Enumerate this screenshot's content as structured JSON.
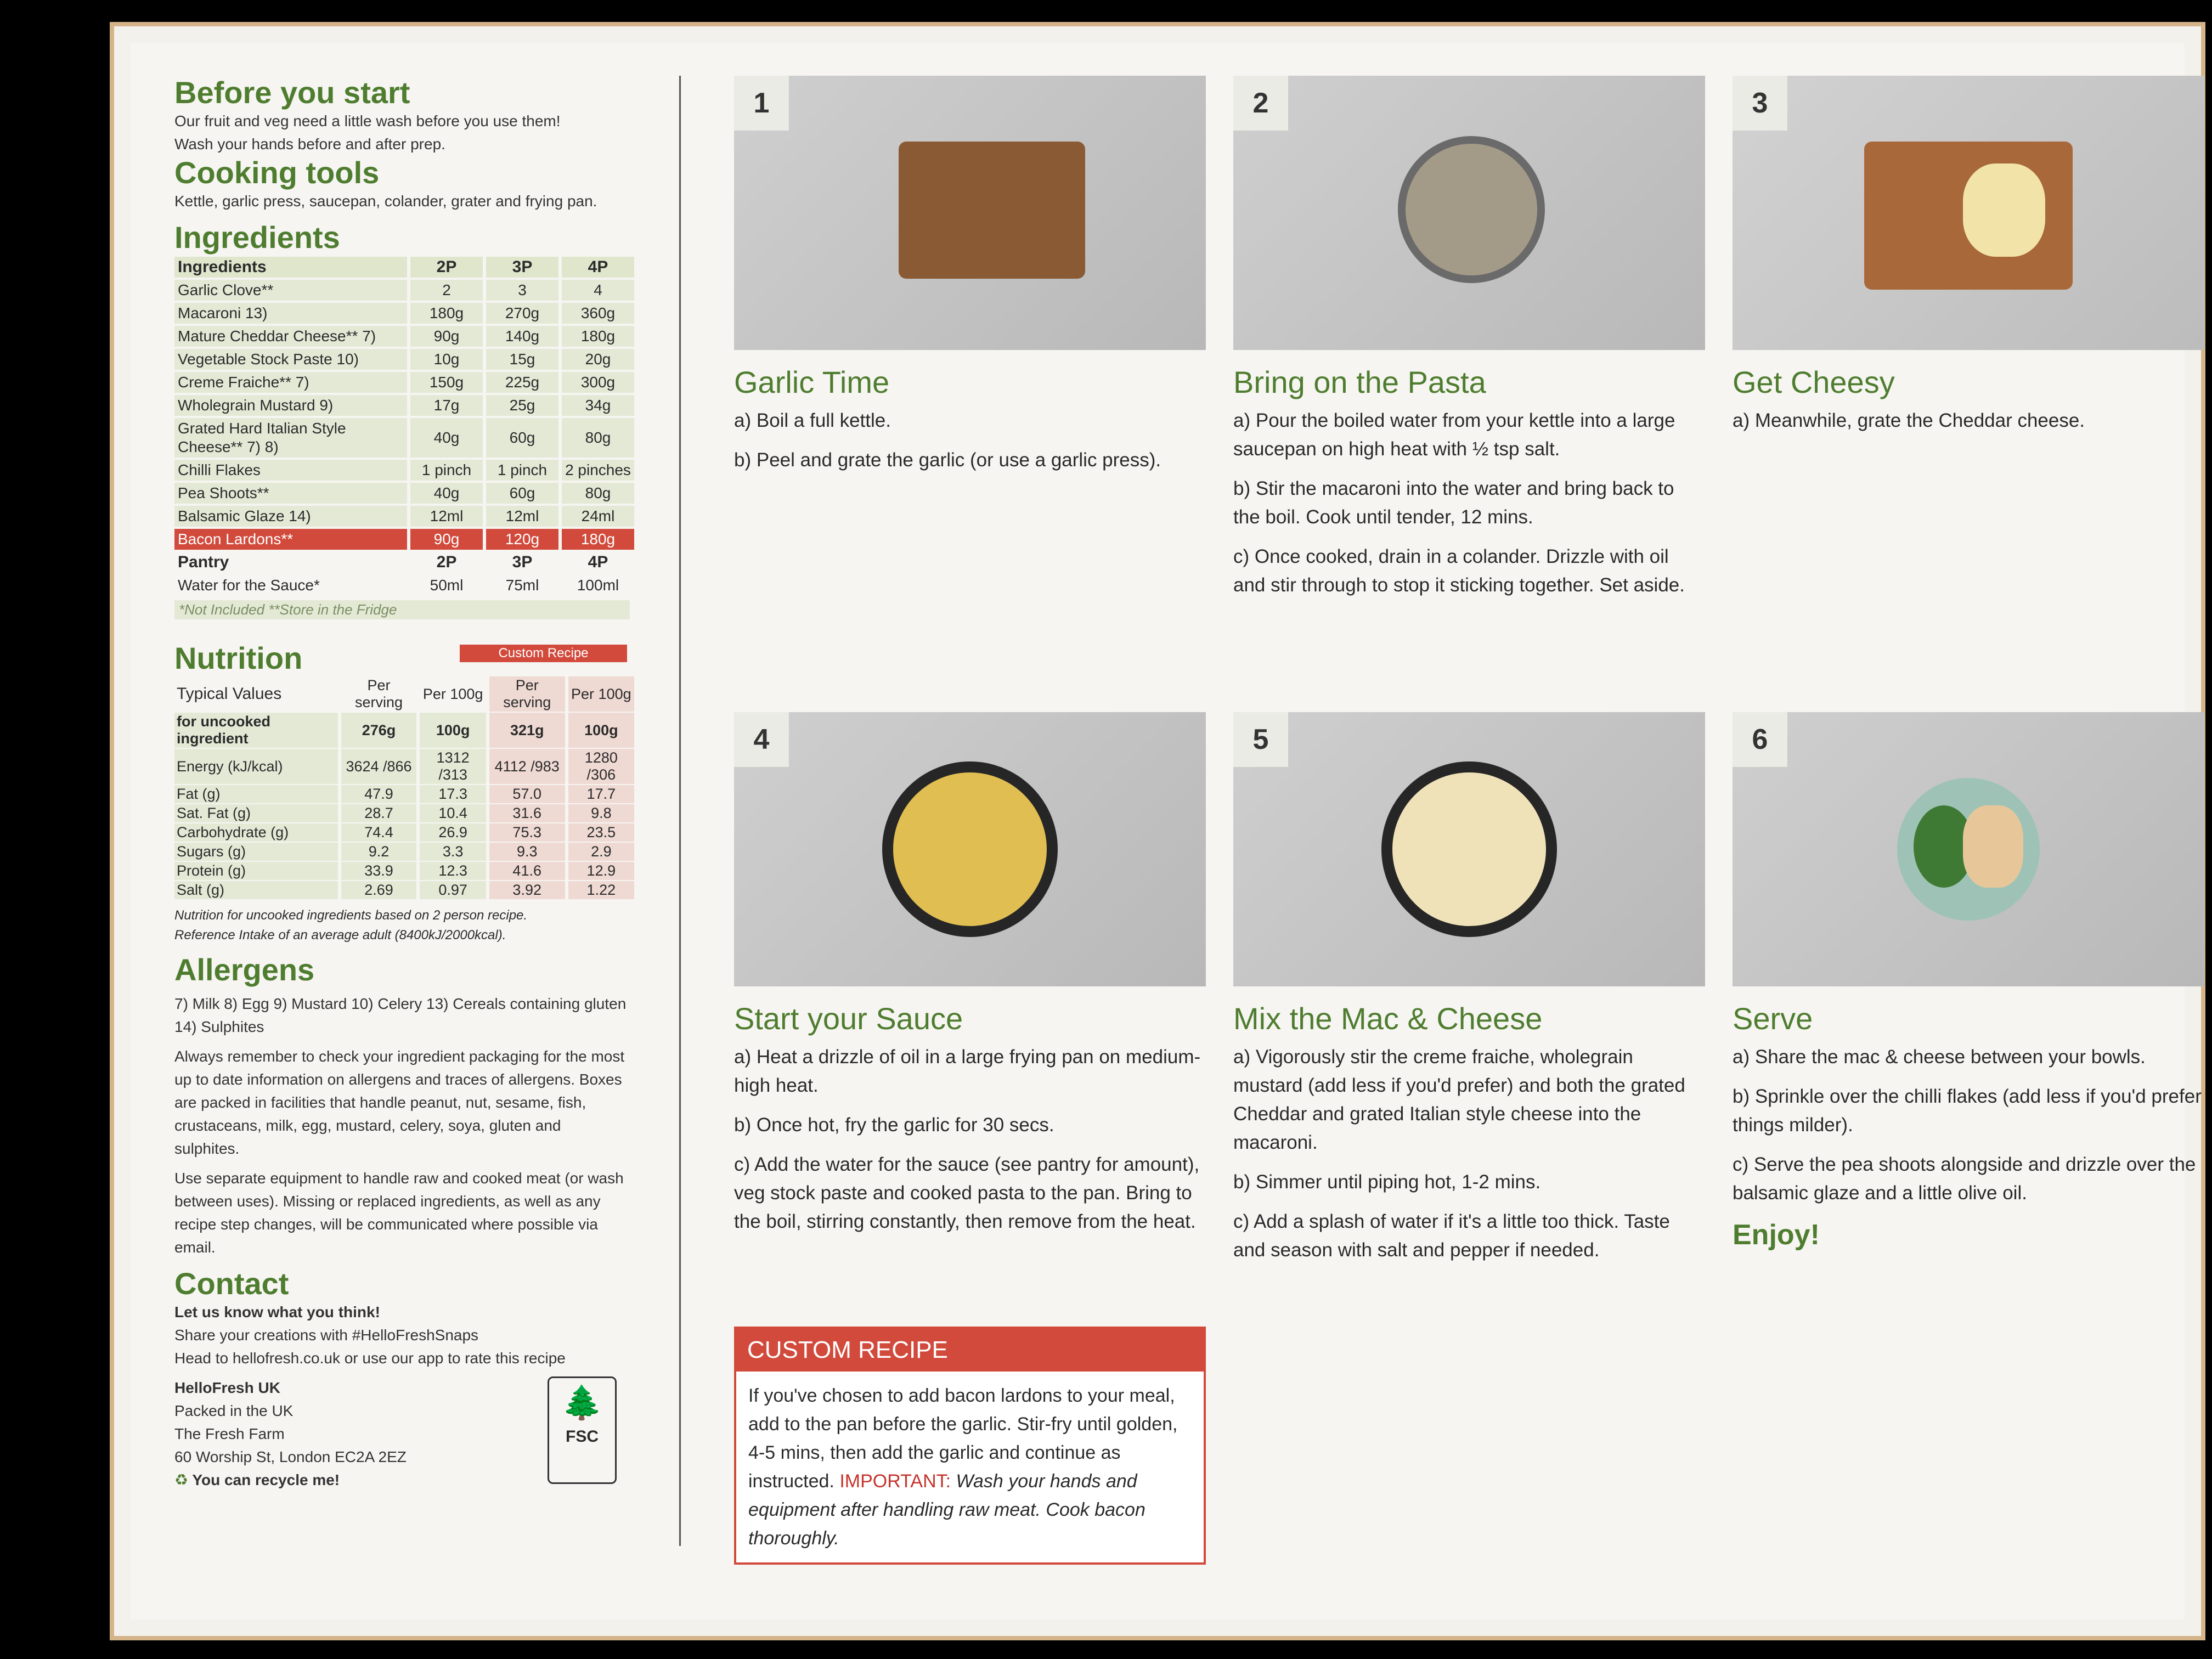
{
  "before": {
    "title": "Before you start",
    "l1": "Our fruit and veg need a little wash before you use them!",
    "l2": "Wash your hands before and after prep."
  },
  "tools": {
    "title": "Cooking tools",
    "text": "Kettle, garlic press, saucepan, colander, grater and frying pan."
  },
  "ingredients": {
    "title": "Ingredients",
    "header": [
      "Ingredients",
      "2P",
      "3P",
      "4P"
    ],
    "rows": [
      [
        "Garlic Clove**",
        "2",
        "3",
        "4"
      ],
      [
        "Macaroni 13)",
        "180g",
        "270g",
        "360g"
      ],
      [
        "Mature Cheddar Cheese** 7)",
        "90g",
        "140g",
        "180g"
      ],
      [
        "Vegetable Stock Paste 10)",
        "10g",
        "15g",
        "20g"
      ],
      [
        "Creme Fraiche** 7)",
        "150g",
        "225g",
        "300g"
      ],
      [
        "Wholegrain Mustard 9)",
        "17g",
        "25g",
        "34g"
      ],
      [
        "Grated Hard Italian Style Cheese** 7) 8)",
        "40g",
        "60g",
        "80g"
      ],
      [
        "Chilli Flakes",
        "1 pinch",
        "1 pinch",
        "2 pinches"
      ],
      [
        "Pea Shoots**",
        "40g",
        "60g",
        "80g"
      ],
      [
        "Balsamic Glaze 14)",
        "12ml",
        "12ml",
        "24ml"
      ]
    ],
    "custom_row": [
      "Bacon Lardons**",
      "90g",
      "120g",
      "180g"
    ],
    "pantry_header": [
      "Pantry",
      "2P",
      "3P",
      "4P"
    ],
    "pantry_row": [
      "Water for the Sauce*",
      "50ml",
      "75ml",
      "100ml"
    ],
    "footnote": "*Not Included  **Store in the Fridge"
  },
  "nutrition": {
    "title": "Nutrition",
    "custom_label": "Custom Recipe",
    "header": [
      "Typical Values",
      "Per serving",
      "Per 100g",
      "Per serving",
      "Per 100g"
    ],
    "rows": [
      [
        "for uncooked ingredient",
        "276g",
        "100g",
        "321g",
        "100g"
      ],
      [
        "Energy (kJ/kcal)",
        "3624 /866",
        "1312 /313",
        "4112 /983",
        "1280 /306"
      ],
      [
        "Fat (g)",
        "47.9",
        "17.3",
        "57.0",
        "17.7"
      ],
      [
        "Sat. Fat (g)",
        "28.7",
        "10.4",
        "31.6",
        "9.8"
      ],
      [
        "Carbohydrate (g)",
        "74.4",
        "26.9",
        "75.3",
        "23.5"
      ],
      [
        "Sugars (g)",
        "9.2",
        "3.3",
        "9.3",
        "2.9"
      ],
      [
        "Protein (g)",
        "33.9",
        "12.3",
        "41.6",
        "12.9"
      ],
      [
        "Salt (g)",
        "2.69",
        "0.97",
        "3.92",
        "1.22"
      ]
    ],
    "note1": "Nutrition for uncooked ingredients based on 2 person recipe.",
    "note2": "Reference Intake of an average adult (8400kJ/2000kcal)."
  },
  "allergens": {
    "title": "Allergens",
    "list": "7) Milk 8) Egg 9) Mustard 10) Celery 13) Cereals containing gluten 14) Sulphites",
    "p1": "Always remember to check your ingredient packaging for the most up to date information on allergens and traces of allergens. Boxes are packed in facilities that handle peanut, nut, sesame, fish, crustaceans, milk, egg, mustard, celery, soya, gluten and sulphites.",
    "p2": "Use separate equipment to handle raw and cooked meat (or wash between uses). Missing or replaced ingredients, as well as any recipe step changes, will be communicated where possible via email."
  },
  "contact": {
    "title": "Contact",
    "l1": "Let us know what you think!",
    "l2": "Share your creations with #HelloFreshSnaps",
    "l3": "Head to hellofresh.co.uk or use our app to rate this recipe",
    "company": "HelloFresh UK",
    "a1": "Packed in the UK",
    "a2": "The Fresh Farm",
    "a3": "60 Worship St, London EC2A 2EZ",
    "recycle": "You can recycle me!",
    "fsc": "FSC"
  },
  "steps": [
    {
      "num": "1",
      "title": "Garlic Time",
      "lines": [
        "a) Boil a full kettle.",
        "b) Peel and grate the garlic (or use a garlic press)."
      ]
    },
    {
      "num": "2",
      "title": "Bring on the Pasta",
      "lines": [
        "a) Pour the boiled water from your kettle into a large saucepan on high heat with ½ tsp salt.",
        "b) Stir the macaroni into the water and bring back to the boil. Cook until tender, 12 mins.",
        "c) Once cooked, drain in a colander. Drizzle with oil and stir through to stop it sticking together. Set aside."
      ]
    },
    {
      "num": "3",
      "title": "Get Cheesy",
      "lines": [
        "a) Meanwhile, grate the Cheddar cheese."
      ]
    },
    {
      "num": "4",
      "title": "Start your Sauce",
      "lines": [
        "a) Heat a drizzle of oil in a large frying pan on medium-high heat.",
        "b) Once hot, fry the garlic for 30 secs.",
        "c) Add the water for the sauce (see pantry for amount), veg stock paste and cooked pasta to the pan. Bring to the boil, stirring constantly, then remove from the heat."
      ]
    },
    {
      "num": "5",
      "title": "Mix the Mac & Cheese",
      "lines": [
        "a) Vigorously stir the creme fraiche, wholegrain mustard (add less if you'd prefer) and both the grated Cheddar and grated Italian style cheese into the macaroni.",
        "b) Simmer until piping hot, 1-2 mins.",
        "c) Add a splash of water if it's a little too thick. Taste and season with salt and pepper if needed."
      ]
    },
    {
      "num": "6",
      "title": "Serve",
      "lines": [
        "a) Share the mac & cheese between your bowls.",
        "b) Sprinkle over the chilli flakes (add less if you'd prefer things milder).",
        "c) Serve the pea shoots alongside and drizzle over the balsamic glaze and a little olive oil."
      ]
    }
  ],
  "enjoy": "Enjoy!",
  "custom": {
    "title": "CUSTOM RECIPE",
    "t1": "If you've chosen to add bacon lardons to your meal, add to the pan before the garlic. Stir-fry until golden, 4-5 mins, then add the garlic and continue as instructed.",
    "important": "IMPORTANT:",
    "t2": "Wash your hands and equipment after handling raw meat. Cook bacon thoroughly."
  }
}
